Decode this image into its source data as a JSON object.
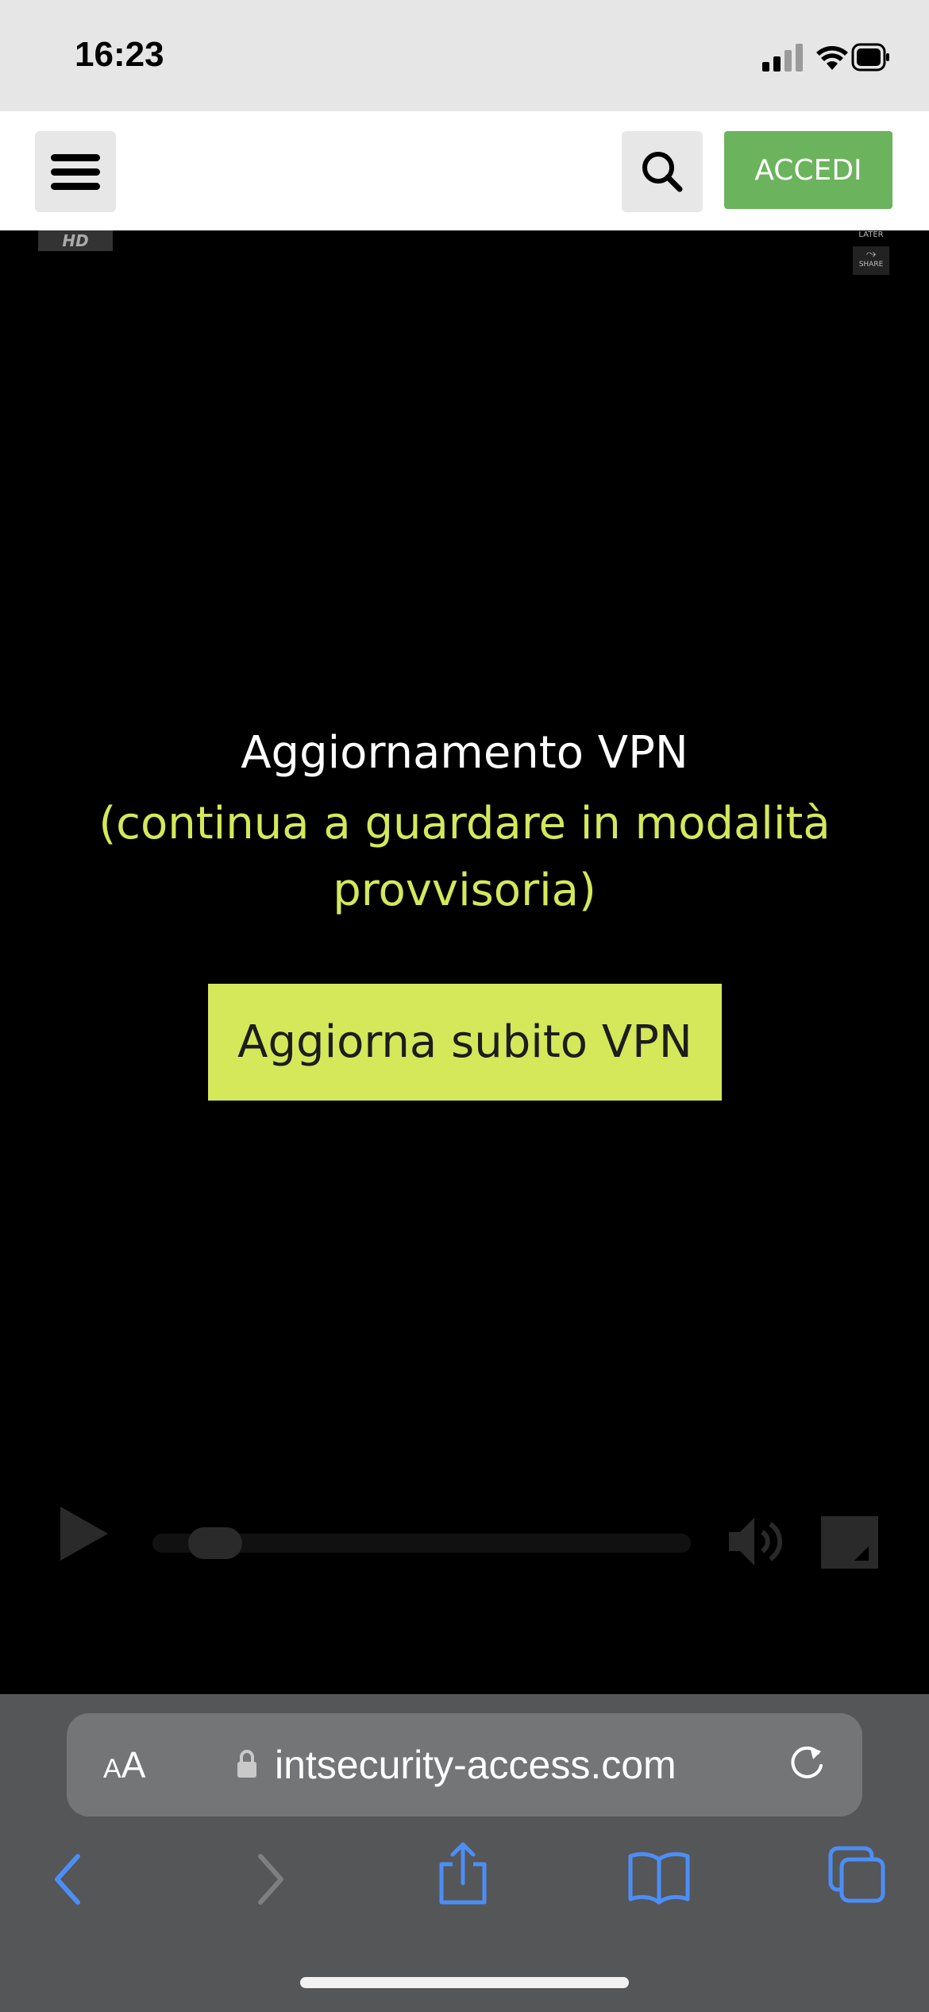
{
  "status_bar": {
    "time": "16:23",
    "icons": [
      "signal-icon",
      "wifi-icon",
      "battery-icon"
    ]
  },
  "header": {
    "menu_icon": "hamburger-icon",
    "search_icon": "search-icon",
    "login_label": "ACCEDI",
    "login_color": "#6bb35c"
  },
  "video": {
    "hd_badge": "HD",
    "later_label": "LATER",
    "share_label": "SHARE",
    "message_title": "Aggiornamento VPN",
    "message_subtitle": "(continua a guardare in modalità provvisoria)",
    "cta_label": "Aggiorna subito VPN",
    "accent_color": "#d4e85a",
    "controls": {
      "play_icon": "play-icon",
      "progress": 0.07,
      "volume_icon": "volume-icon",
      "fullscreen_icon": "fullscreen-icon"
    }
  },
  "safari": {
    "text_size_small": "A",
    "text_size_big": "A",
    "lock_icon": "lock-icon",
    "url": "intsecurity-access.com",
    "reload_icon": "reload-icon",
    "toolbar": [
      "back-icon",
      "forward-icon",
      "share-icon",
      "bookmarks-icon",
      "tabs-icon"
    ],
    "accent_color": "#4c8ef7"
  }
}
